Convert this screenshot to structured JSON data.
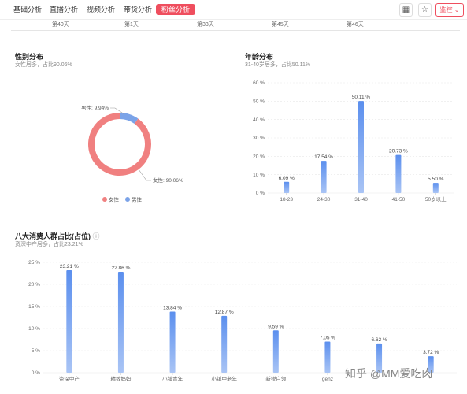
{
  "tabs": [
    {
      "label": "基础分析"
    },
    {
      "label": "直播分析"
    },
    {
      "label": "视频分析"
    },
    {
      "label": "带货分析"
    },
    {
      "label": "粉丝分析"
    }
  ],
  "toolbar": {
    "monitor_label": "监控"
  },
  "top_strip": [
    "第40天",
    "第1天",
    "第33天",
    "第45天",
    "第46天"
  ],
  "watermark": "知乎 @MM爱吃肉",
  "chart_data": [
    {
      "type": "pie",
      "title": "性别分布",
      "subtitle": "女性居多，占比90.06%",
      "slices": [
        {
          "label": "女性",
          "value": 90.06,
          "text": "女性: 90.06%",
          "color": "#f08080"
        },
        {
          "label": "男性",
          "value": 9.94,
          "text": "男性: 9.94%",
          "color": "#7ba3e8"
        }
      ],
      "legend": "bottom-center"
    },
    {
      "type": "bar",
      "title": "年龄分布",
      "subtitle": "31-40岁居多，占比50.11%",
      "categories": [
        "18-23",
        "24-30",
        "31-40",
        "41-50",
        "50岁以上"
      ],
      "values": [
        6.09,
        17.54,
        50.11,
        20.73,
        5.5
      ],
      "value_labels": [
        "6.09 %",
        "17.54 %",
        "50.11 %",
        "20.73 %",
        "5.50 %"
      ],
      "y_ticks": [
        "0 %",
        "10 %",
        "20 %",
        "30 %",
        "40 %",
        "50 %",
        "60 %"
      ],
      "ylim": [
        0,
        60
      ],
      "color": "#6b9ff0"
    },
    {
      "type": "bar",
      "title": "八大消费人群占比(占位)",
      "subtitle": "资深中产居多，占比23.21%",
      "categories": [
        "资深中产",
        "精致妈妈",
        "小镇青年",
        "小镇中老年",
        "新锐白领",
        "genz",
        "",
        ""
      ],
      "values": [
        23.21,
        22.86,
        13.84,
        12.87,
        9.59,
        7.05,
        6.62,
        3.72
      ],
      "value_labels": [
        "23.21 %",
        "22.86 %",
        "13.84 %",
        "12.87 %",
        "9.59 %",
        "7.05 %",
        "6.62 %",
        "3.72 %"
      ],
      "y_ticks": [
        "0 %",
        "5 %",
        "10 %",
        "15 %",
        "20 %",
        "25 %"
      ],
      "ylim": [
        0,
        25
      ],
      "color": "#6b9ff0"
    }
  ]
}
